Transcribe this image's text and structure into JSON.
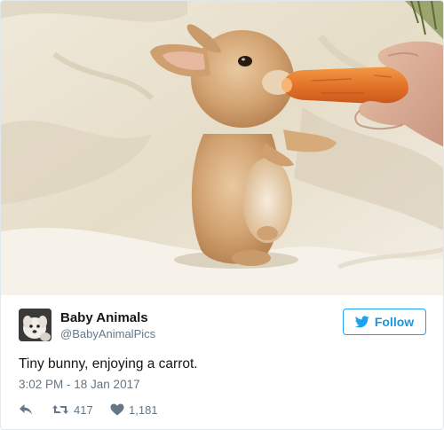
{
  "tweet": {
    "author": {
      "name": "Baby Animals",
      "handle": "@BabyAnimalPics"
    },
    "follow_label": "Follow",
    "text": "Tiny bunny, enjoying a carrot.",
    "timestamp": "3:02 PM - 18 Jan 2017",
    "stats": {
      "retweets": "417",
      "likes": "1,181"
    }
  },
  "icons": {
    "reply": "reply-arrow-icon",
    "retweet": "retweet-icon",
    "like": "heart-icon",
    "follow": "twitter-bird-icon"
  },
  "colors": {
    "accent": "#1da1f2",
    "secondary_text": "#657786",
    "border": "#e1e8ed"
  }
}
